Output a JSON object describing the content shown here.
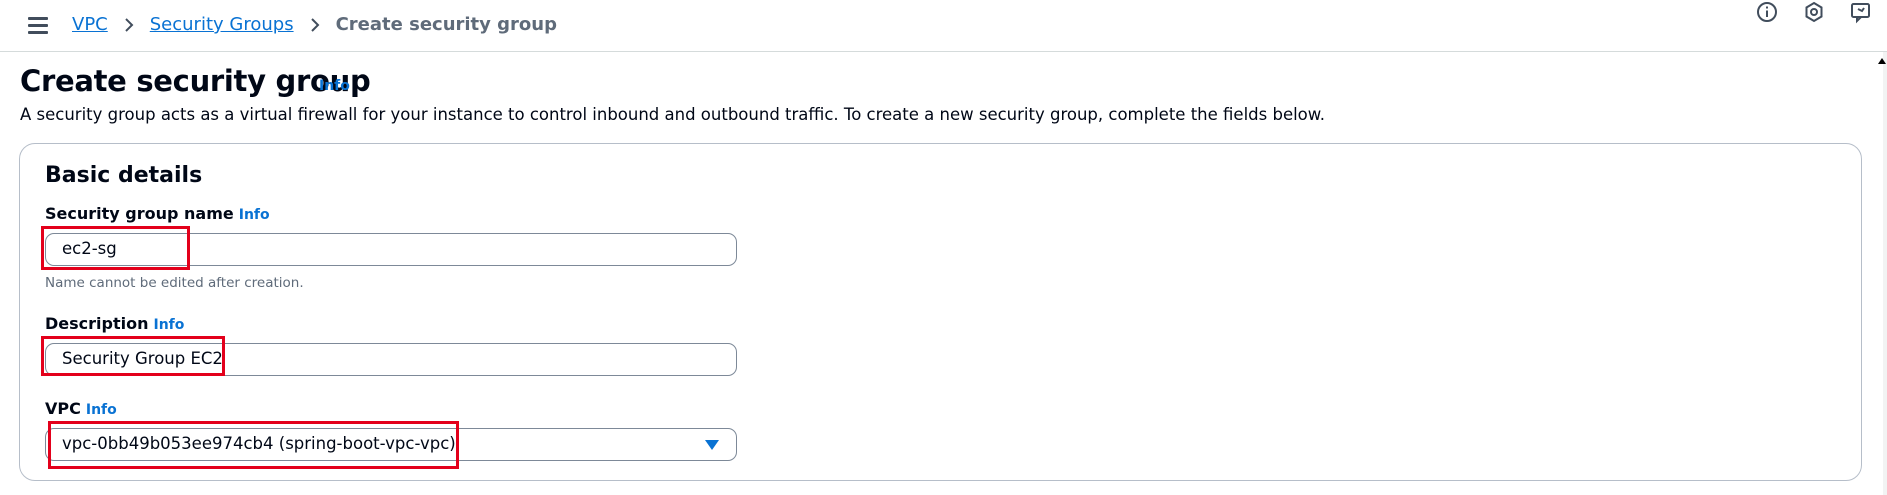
{
  "breadcrumb": {
    "items": [
      "VPC",
      "Security Groups"
    ],
    "current": "Create security group"
  },
  "header": {
    "title": "Create security group",
    "info_label": "Info",
    "description": "A security group acts as a virtual firewall for your instance to control inbound and outbound traffic. To create a new security group, complete the fields below."
  },
  "basic_details": {
    "title": "Basic details",
    "name_field": {
      "label": "Security group name",
      "info_label": "Info",
      "value": "ec2-sg",
      "hint": "Name cannot be edited after creation."
    },
    "description_field": {
      "label": "Description",
      "info_label": "Info",
      "value": "Security Group EC2"
    },
    "vpc_field": {
      "label": "VPC",
      "info_label": "Info",
      "value": "vpc-0bb49b053ee974cb4 (spring-boot-vpc-vpc)"
    }
  },
  "top_icons": [
    "info-icon",
    "settings-hexagon-icon",
    "feedback-icon"
  ],
  "colors": {
    "link": "#0972d3",
    "text": "#000716",
    "muted": "#5f6b7a",
    "highlight": "#e3001b",
    "border": "#7d8998"
  }
}
